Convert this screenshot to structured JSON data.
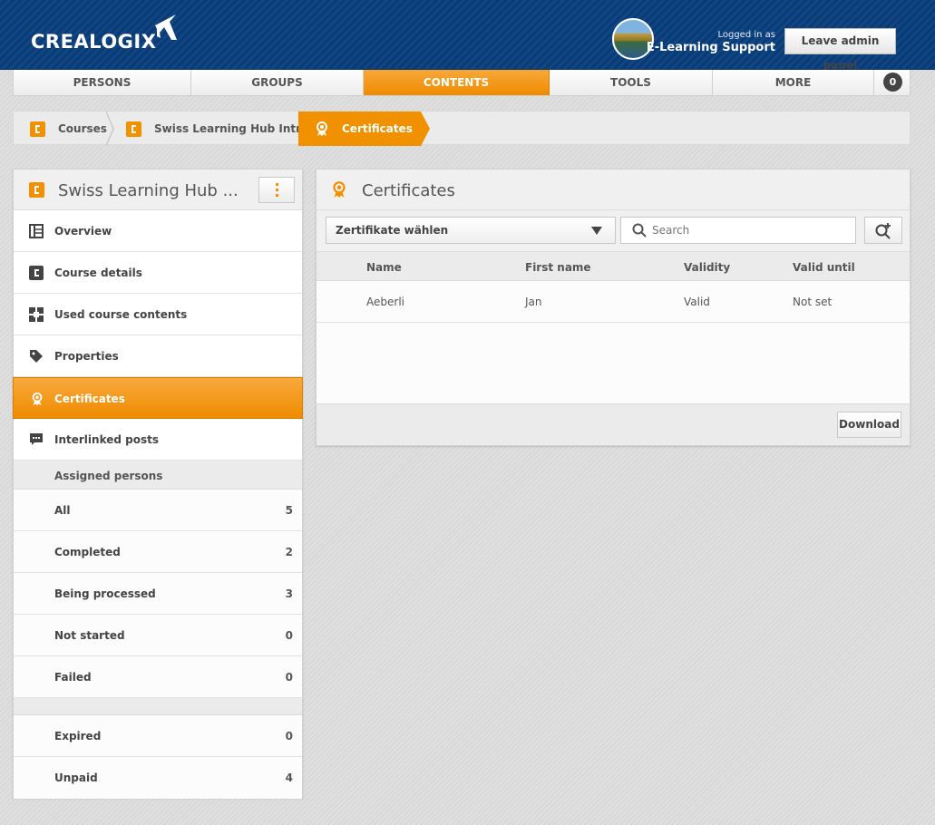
{
  "header": {
    "logo_text": "CREALOGIX",
    "login_small": "Logged in as",
    "login_name": "E-Learning Support",
    "leave_button": "Leave admin panel"
  },
  "nav": {
    "items": [
      {
        "label": "PERSONS",
        "active": false
      },
      {
        "label": "GROUPS",
        "active": false
      },
      {
        "label": "CONTENTS",
        "active": true
      },
      {
        "label": "TOOLS",
        "active": false
      },
      {
        "label": "MORE",
        "active": false
      }
    ],
    "badge": "0"
  },
  "breadcrumb": {
    "items": [
      "Courses",
      "Swiss Learning Hub Intro",
      "Certificates"
    ]
  },
  "sidebar": {
    "title": "Swiss Learning Hub ...",
    "items": [
      {
        "label": "Overview",
        "icon": "overview-icon"
      },
      {
        "label": "Course details",
        "icon": "course-icon"
      },
      {
        "label": "Used course contents",
        "icon": "contents-icon"
      },
      {
        "label": "Properties",
        "icon": "tag-icon"
      },
      {
        "label": "Certificates",
        "icon": "certificate-icon"
      },
      {
        "label": "Interlinked posts",
        "icon": "comment-icon"
      }
    ],
    "assigned_header": "Assigned persons",
    "assigned": [
      {
        "label": "All",
        "count": "5"
      },
      {
        "label": "Completed",
        "count": "2"
      },
      {
        "label": "Being processed",
        "count": "3"
      },
      {
        "label": "Not started",
        "count": "0"
      },
      {
        "label": "Failed",
        "count": "0"
      }
    ],
    "extra": [
      {
        "label": "Expired",
        "count": "0"
      },
      {
        "label": "Unpaid",
        "count": "4"
      }
    ]
  },
  "panel": {
    "title": "Certificates",
    "select_value": "Zertifikate wählen",
    "search_placeholder": "Search",
    "columns": [
      "Name",
      "First name",
      "Validity",
      "Valid until"
    ],
    "rows": [
      {
        "name": "Aeberli",
        "first_name": "Jan",
        "validity": "Valid",
        "valid_until": "Not set"
      }
    ],
    "download_button": "Download"
  },
  "colors": {
    "accent": "#f29100",
    "header_blue": "#0d3f7a"
  }
}
